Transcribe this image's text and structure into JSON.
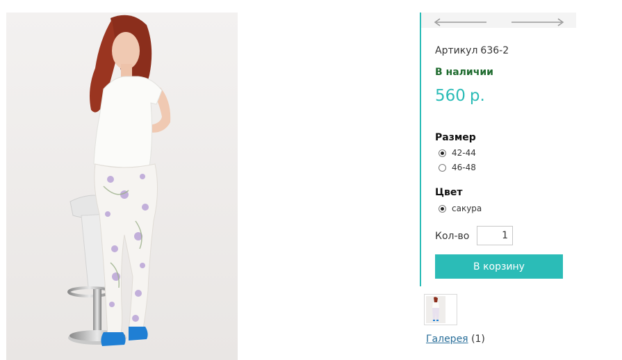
{
  "product": {
    "sku_label": "Артикул",
    "sku_value": "636-2",
    "stock": "В наличии",
    "price": "560",
    "currency": "р."
  },
  "options": {
    "size": {
      "title": "Размер",
      "items": [
        {
          "label": "42-44",
          "checked": true
        },
        {
          "label": "46-48",
          "checked": false
        }
      ]
    },
    "color": {
      "title": "Цвет",
      "items": [
        {
          "label": "сакура",
          "checked": true
        }
      ]
    }
  },
  "quantity": {
    "label": "Кол-во",
    "value": "1"
  },
  "cart_button": "В корзину",
  "gallery": {
    "link": "Галерея",
    "count": "(1)"
  },
  "nav": {
    "prev_icon": "arrow-left-icon",
    "next_icon": "arrow-right-icon"
  },
  "colors": {
    "accent": "#2bbcb7",
    "in_stock": "#1e6b2e",
    "link": "#2a6f9a"
  }
}
